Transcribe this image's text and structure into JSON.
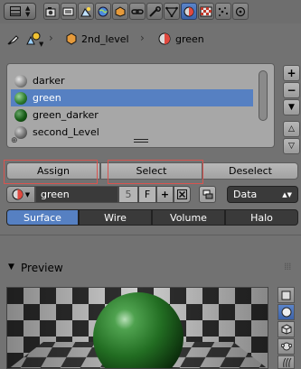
{
  "tabs": [
    {
      "icon": "render-icon"
    },
    {
      "icon": "render-layers-icon"
    },
    {
      "icon": "scene-icon"
    },
    {
      "icon": "world-icon"
    },
    {
      "icon": "object-icon"
    },
    {
      "icon": "constraints-icon"
    },
    {
      "icon": "modifiers-icon"
    },
    {
      "icon": "data-icon"
    },
    {
      "icon": "material-icon",
      "active": true
    },
    {
      "icon": "texture-icon"
    },
    {
      "icon": "particles-icon"
    },
    {
      "icon": "physics-icon"
    }
  ],
  "breadcrumb": {
    "object": "2nd_level",
    "material": "green"
  },
  "material_list": [
    {
      "name": "darker",
      "ball": "grey"
    },
    {
      "name": "green",
      "ball": "green",
      "selected": true
    },
    {
      "name": "green_darker",
      "ball": "dgreen"
    },
    {
      "name": "second_Level",
      "ball": "darkgrey"
    }
  ],
  "buttons": {
    "assign": "Assign",
    "select": "Select",
    "deselect": "Deselect"
  },
  "material_id": {
    "name": "green",
    "users": "5",
    "fake_user": "F",
    "data_type": "Data"
  },
  "surface_tabs": {
    "surface": "Surface",
    "wire": "Wire",
    "volume": "Volume",
    "halo": "Halo"
  },
  "preview": {
    "title": "Preview"
  },
  "colors": {
    "accent": "#5680c2",
    "sphere": "#2f7d2f",
    "highlight_box": "#d9534f"
  }
}
